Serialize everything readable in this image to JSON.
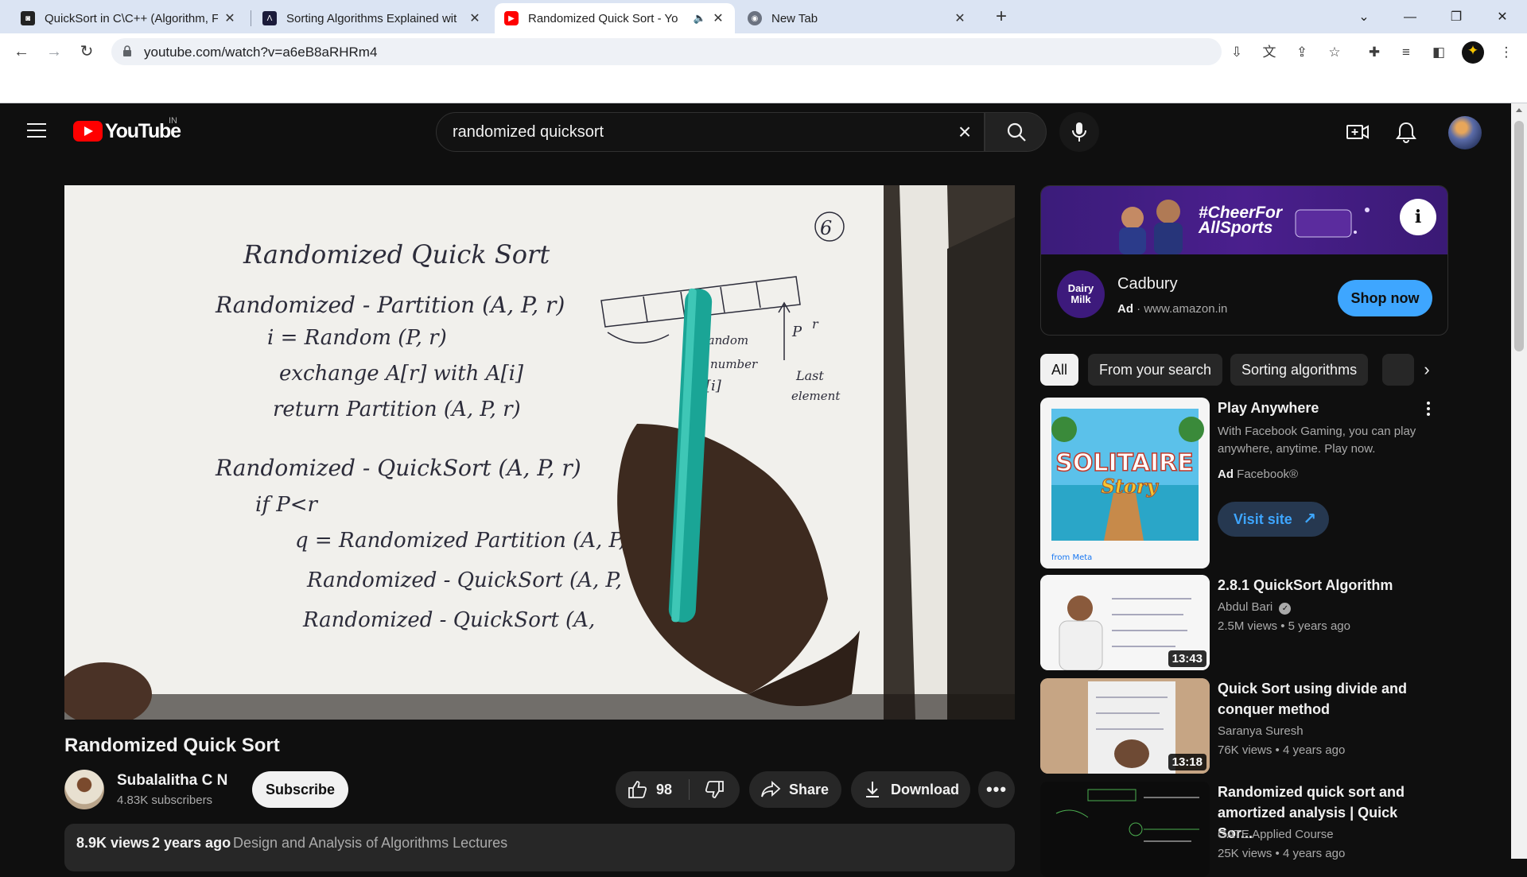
{
  "browser": {
    "tabs": [
      {
        "title": "QuickSort in C\\C++ (Algorithm, F",
        "favicon": "dark-site-icon"
      },
      {
        "title": "Sorting Algorithms Explained wit",
        "favicon": "dark-site-icon"
      },
      {
        "title": "Randomized Quick Sort - Yo",
        "favicon": "youtube-icon",
        "active": true,
        "audio": true
      },
      {
        "title": "New Tab",
        "favicon": "chrome-icon"
      }
    ],
    "url": "youtube.com/watch?v=a6eB8aRHRm4"
  },
  "youtube": {
    "logo_text": "YouTube",
    "country_code": "IN",
    "search_query": "randomized quicksort",
    "video": {
      "title": "Randomized Quick Sort",
      "channel": "Subalalitha C N",
      "subscribers": "4.83K subscribers",
      "subscribe_label": "Subscribe",
      "likes": "98",
      "share_label": "Share",
      "download_label": "Download",
      "views": "8.9K views",
      "uploaded": "2 years ago",
      "playlist": "Design and Analysis of Algorithms Lectures"
    },
    "whiteboard": {
      "page_no": "6",
      "lines": [
        "Randomized   Quick Sort",
        "Randomized - Partition (A, P, r)",
        "i = Random (P, r)",
        "exchange A[r] with A[i]",
        "return  Partition (A, P, r)",
        "Randomized - QuickSort (A, P, r)",
        "if P<r",
        "q = Randomized Partition (A, P, r)",
        "Randomized - QuickSort (A, P,",
        "Randomized - QuickSort (A,"
      ],
      "array_notes": [
        "Random",
        "number",
        "[i]",
        "Last",
        "element",
        "P",
        "r"
      ]
    },
    "ad": {
      "banner_hashtag_line1": "#CheerFor",
      "banner_hashtag_line2": "AllSports",
      "logo_line1": "Dairy",
      "logo_line2": "Milk",
      "brand": "Cadbury",
      "ad_label": "Ad",
      "domain": "www.amazon.in",
      "cta": "Shop now"
    },
    "chips": [
      "All",
      "From your search",
      "Sorting algorithms"
    ],
    "recommendations": [
      {
        "title": "Play Anywhere",
        "desc": "With Facebook Gaming, you can play anywhere, anytime. Play now.",
        "ad_label": "Ad",
        "advertiser": "Facebook®",
        "cta": "Visit site",
        "thumb_text_1": "SOLITAIRE",
        "thumb_text_2": "Story",
        "thumb_footer": "from Meta"
      },
      {
        "title": "2.8.1 QuickSort Algorithm",
        "channel": "Abdul Bari",
        "meta": "2.5M views  • 5 years ago",
        "duration": "13:43"
      },
      {
        "title": "Quick Sort using divide and conquer method",
        "channel": "Saranya Suresh",
        "meta": "76K views  • 4 years ago",
        "duration": "13:18"
      },
      {
        "title": "Randomized quick sort and amortized analysis | Quick Sor...",
        "channel": "GATE Applied Course",
        "meta": "25K views  • 4 years ago"
      }
    ]
  }
}
